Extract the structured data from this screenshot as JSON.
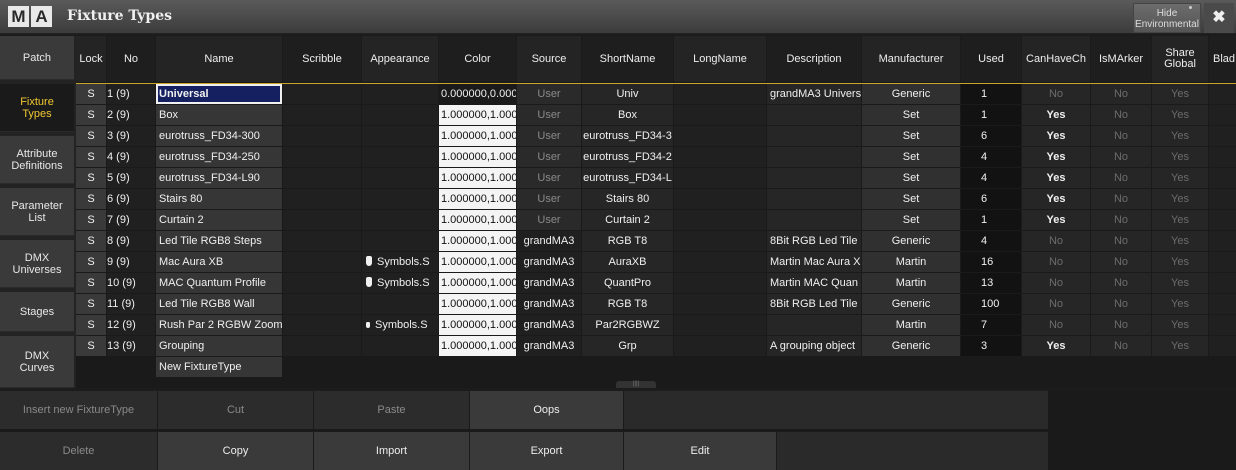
{
  "window": {
    "logo_letters": [
      "M",
      "A"
    ],
    "title": "Fixture Types",
    "hide_button": "Hide\nEnvironmental",
    "close_icon": "close-icon"
  },
  "nav": [
    {
      "label": "Patch",
      "active": false
    },
    {
      "label": "Fixture\nTypes",
      "active": true
    },
    {
      "label": "Attribute\nDefinitions",
      "active": false
    },
    {
      "label": "Parameter\nList",
      "active": false
    },
    {
      "label": "DMX\nUniverses",
      "active": false
    },
    {
      "label": "Stages",
      "active": false
    },
    {
      "label": "DMX\nCurves",
      "active": false
    }
  ],
  "columns": [
    "Lock",
    "No",
    "Name",
    "Scribble",
    "Appearance",
    "Color",
    "Source",
    "ShortName",
    "LongName",
    "Description",
    "Manufacturer",
    "Used",
    "CanHaveCh",
    "IsMArker",
    "Share\nGlobal",
    "Blad"
  ],
  "rows": [
    {
      "lock": "S",
      "no": "1 (9)",
      "name": "Universal",
      "appearance": "",
      "color": "0.000000,0.000",
      "source": "User",
      "short": "Univ",
      "desc": "grandMA3 Univers",
      "manu": "Generic",
      "used": "1",
      "canhave": "No",
      "ismarker": "No",
      "share": "Yes"
    },
    {
      "lock": "S",
      "no": "2 (9)",
      "name": "Box",
      "appearance": "",
      "color": "1.000000,1.000",
      "source": "User",
      "short": "Box",
      "desc": "",
      "manu": "Set",
      "used": "1",
      "canhave": "Yes",
      "ismarker": "No",
      "share": "Yes"
    },
    {
      "lock": "S",
      "no": "3 (9)",
      "name": "eurotruss_FD34-300",
      "appearance": "",
      "color": "1.000000,1.000",
      "source": "User",
      "short": "eurotruss_FD34-3",
      "desc": "",
      "manu": "Set",
      "used": "6",
      "canhave": "Yes",
      "ismarker": "No",
      "share": "Yes"
    },
    {
      "lock": "S",
      "no": "4 (9)",
      "name": "eurotruss_FD34-250",
      "appearance": "",
      "color": "1.000000,1.000",
      "source": "User",
      "short": "eurotruss_FD34-2",
      "desc": "",
      "manu": "Set",
      "used": "4",
      "canhave": "Yes",
      "ismarker": "No",
      "share": "Yes"
    },
    {
      "lock": "S",
      "no": "5 (9)",
      "name": "eurotruss_FD34-L90",
      "appearance": "",
      "color": "1.000000,1.000",
      "source": "User",
      "short": "eurotruss_FD34-L",
      "desc": "",
      "manu": "Set",
      "used": "4",
      "canhave": "Yes",
      "ismarker": "No",
      "share": "Yes"
    },
    {
      "lock": "S",
      "no": "6 (9)",
      "name": "Stairs 80",
      "appearance": "",
      "color": "1.000000,1.000",
      "source": "User",
      "short": "Stairs 80",
      "desc": "",
      "manu": "Set",
      "used": "6",
      "canhave": "Yes",
      "ismarker": "No",
      "share": "Yes"
    },
    {
      "lock": "S",
      "no": "7 (9)",
      "name": "Curtain 2",
      "appearance": "",
      "color": "1.000000,1.000",
      "source": "User",
      "short": "Curtain 2",
      "desc": "",
      "manu": "Set",
      "used": "1",
      "canhave": "Yes",
      "ismarker": "No",
      "share": "Yes"
    },
    {
      "lock": "S",
      "no": "8 (9)",
      "name": "Led Tile RGB8 Steps",
      "appearance": "",
      "color": "1.000000,1.000",
      "source": "grandMA3",
      "short": "RGB T8",
      "desc": "8Bit RGB Led Tile (",
      "manu": "Generic",
      "used": "4",
      "canhave": "No",
      "ismarker": "No",
      "share": "Yes"
    },
    {
      "lock": "S",
      "no": "9 (9)",
      "name": "Mac Aura XB",
      "appearance": "Symbols.S",
      "color": "1.000000,1.000",
      "source": "grandMA3",
      "short": "AuraXB",
      "desc": "Martin Mac Aura X",
      "manu": "Martin",
      "used": "16",
      "canhave": "No",
      "ismarker": "No",
      "share": "Yes"
    },
    {
      "lock": "S",
      "no": "10 (9)",
      "name": "MAC Quantum Profile",
      "appearance": "Symbols.S",
      "color": "1.000000,1.000",
      "source": "grandMA3",
      "short": "QuantPro",
      "desc": "Martin MAC Quan",
      "manu": "Martin",
      "used": "13",
      "canhave": "No",
      "ismarker": "No",
      "share": "Yes"
    },
    {
      "lock": "S",
      "no": "11 (9)",
      "name": "Led Tile RGB8 Wall",
      "appearance": "",
      "color": "1.000000,1.000",
      "source": "grandMA3",
      "short": "RGB T8",
      "desc": "8Bit RGB Led Tile (",
      "manu": "Generic",
      "used": "100",
      "canhave": "No",
      "ismarker": "No",
      "share": "Yes"
    },
    {
      "lock": "S",
      "no": "12 (9)",
      "name": "Rush Par 2 RGBW Zoom",
      "appearance": "Symbols.S",
      "color": "1.000000,1.000",
      "source": "grandMA3",
      "short": "Par2RGBWZ",
      "desc": "",
      "manu": "Martin",
      "used": "7",
      "canhave": "No",
      "ismarker": "No",
      "share": "Yes"
    },
    {
      "lock": "S",
      "no": "13 (9)",
      "name": "Grouping",
      "appearance": "",
      "color": "1.000000,1.000",
      "source": "grandMA3",
      "short": "Grp",
      "desc": "A grouping object",
      "manu": "Generic",
      "used": "3",
      "canhave": "Yes",
      "ismarker": "No",
      "share": "Yes"
    }
  ],
  "new_row": "New FixtureType",
  "buttons_top": [
    {
      "label": "Insert new FixtureType",
      "enabled": false
    },
    {
      "label": "Cut",
      "enabled": false
    },
    {
      "label": "Paste",
      "enabled": false
    },
    {
      "label": "Oops",
      "enabled": true
    }
  ],
  "buttons_bottom": [
    {
      "label": "Delete",
      "enabled": false
    },
    {
      "label": "Copy",
      "enabled": true
    },
    {
      "label": "Import",
      "enabled": true
    },
    {
      "label": "Export",
      "enabled": true
    },
    {
      "label": "Edit",
      "enabled": true
    }
  ],
  "colors": {
    "accent": "#f0c832",
    "selection": "#142060",
    "separator": "#c9a52a"
  }
}
